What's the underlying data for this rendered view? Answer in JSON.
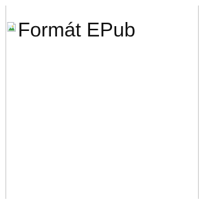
{
  "image": {
    "alt_text": "Formát EPub",
    "icon": "broken-image-icon"
  }
}
